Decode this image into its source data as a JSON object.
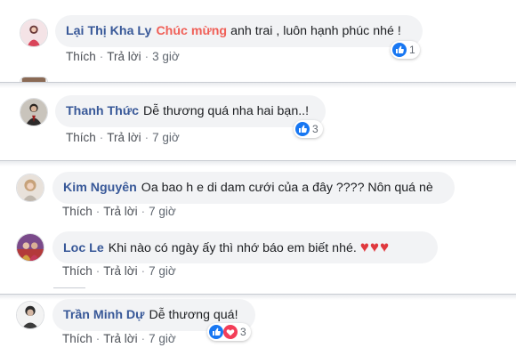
{
  "comments": [
    {
      "author": "Lại Thị Kha Ly",
      "highlight": "Chúc mừng",
      "text": "anh trai , luôn hạnh phúc nhé !",
      "like_label": "Thích",
      "reply_label": "Trả lời",
      "time": "3 giờ",
      "reaction_count": "1",
      "reactions": [
        "like"
      ]
    },
    {
      "author": "Thanh Thức",
      "text": "Dễ thương quá nha hai bạn..!",
      "like_label": "Thích",
      "reply_label": "Trả lời",
      "time": "7 giờ",
      "reaction_count": "3",
      "reactions": [
        "like"
      ]
    },
    {
      "author": "Kim Nguyên",
      "text": "Oa bao h e di dam cưới của a đây ???? Nôn quá nè",
      "like_label": "Thích",
      "reply_label": "Trả lời",
      "time": "7 giờ"
    },
    {
      "author": "Loc Le",
      "text": "Khi nào có ngày ấy thì nhớ báo em biết nhé.",
      "emoji": "♥♥♥",
      "like_label": "Thích",
      "reply_label": "Trả lời",
      "time": "7 giờ"
    },
    {
      "author": "Trần Minh Dự",
      "text": "Dễ thương quá!",
      "like_label": "Thích",
      "reply_label": "Trả lời",
      "time": "7 giờ",
      "reaction_count": "3",
      "reactions": [
        "like",
        "love"
      ]
    }
  ],
  "colors": {
    "author": "#385898",
    "highlight": "#f05f57",
    "like_blue": "#1877f2",
    "love_red": "#f33e58",
    "bubble": "#f2f3f5"
  },
  "icons": [
    "like-icon",
    "love-icon",
    "heart-emoji"
  ]
}
